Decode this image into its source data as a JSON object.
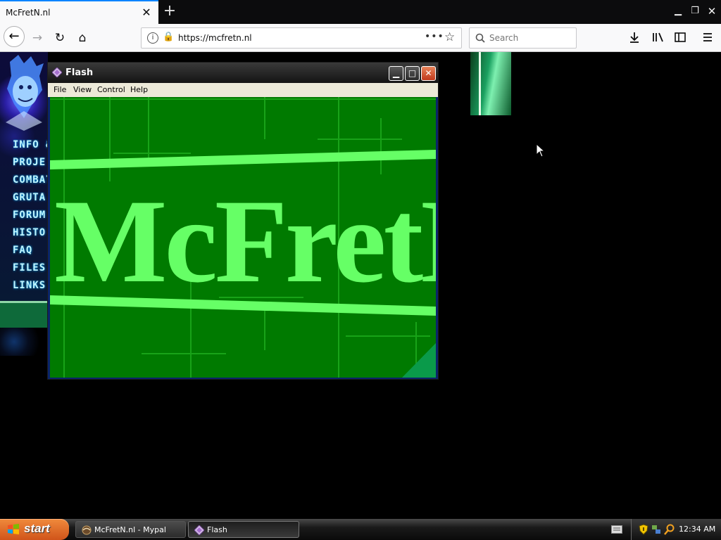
{
  "browser": {
    "tab_title": "McFretN.nl",
    "url": "https://mcfretn.nl",
    "search_placeholder": "Search",
    "accent": "#0a84ff"
  },
  "website": {
    "nav_items": [
      "INFO &",
      "PROJE",
      "COMBAT",
      "GRUTA",
      "FORUM",
      "HISTO",
      "FAQ",
      "FILES",
      "LINKS"
    ]
  },
  "flash_window": {
    "title": "Flash",
    "menu": [
      "File",
      "View",
      "Control",
      "Help"
    ],
    "stage_text": "McFretN",
    "colors": {
      "stage_bg": "#007a00",
      "stage_text": "#66ff66"
    }
  },
  "taskbar": {
    "start_label": "start",
    "tasks": [
      {
        "label": "McFretN.nl - Mypal"
      },
      {
        "label": "Flash"
      }
    ],
    "clock": "12:34 AM"
  }
}
